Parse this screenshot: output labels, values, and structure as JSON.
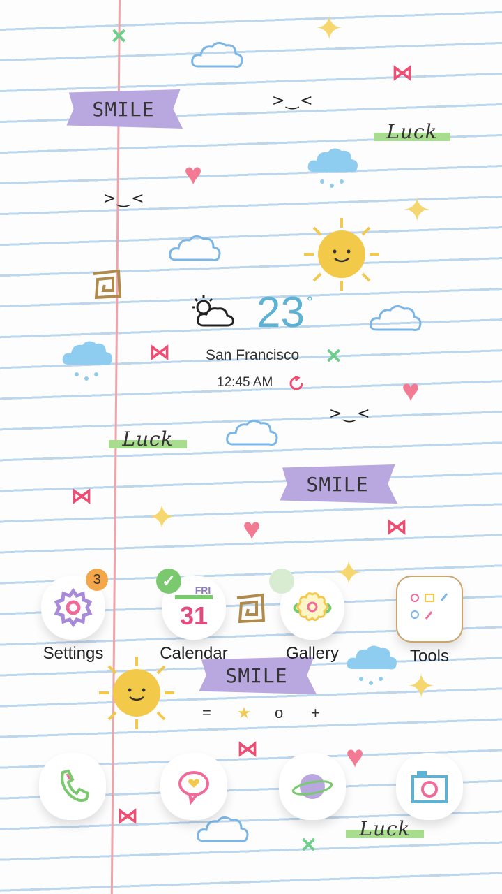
{
  "wallpaper": {
    "tape_texts": {
      "smile": "SMILE",
      "luck": "Luck"
    },
    "face": ">‿<"
  },
  "weather": {
    "temperature": "23",
    "degree_symbol": "°",
    "city": "San Francisco",
    "time": "12:45 AM",
    "condition_icon": "partly-cloudy-icon"
  },
  "apps": [
    {
      "label": "Settings",
      "icon": "gear-icon",
      "badge": "3"
    },
    {
      "label": "Calendar",
      "icon": "calendar-icon",
      "day": "FRI",
      "date": "31"
    },
    {
      "label": "Gallery",
      "icon": "flower-icon"
    },
    {
      "label": "Tools",
      "icon": "tools-folder-icon"
    }
  ],
  "page_indicator": {
    "items": [
      "=",
      "★",
      "o",
      "+"
    ]
  },
  "dock": [
    {
      "icon": "phone-icon"
    },
    {
      "icon": "message-icon"
    },
    {
      "icon": "internet-planet-icon"
    },
    {
      "icon": "camera-icon"
    }
  ],
  "colors": {
    "accent_blue": "#5eb3d4",
    "badge_orange": "#f4a64a",
    "calendar_pink": "#e34b7e",
    "calendar_green": "#7bc96f"
  }
}
